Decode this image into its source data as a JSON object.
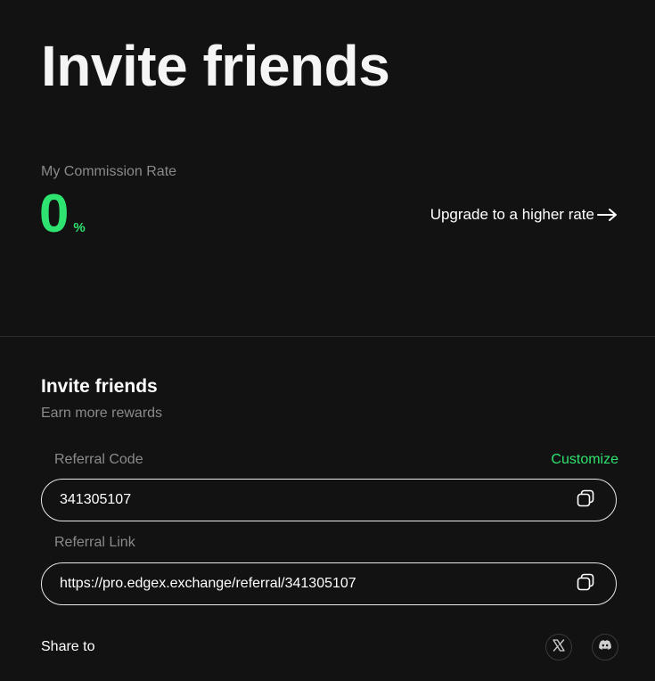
{
  "page": {
    "title": "Invite friends"
  },
  "commission": {
    "label": "My Commission Rate",
    "value": "0",
    "unit": "%",
    "upgrade_label": "Upgrade to a higher rate",
    "accent_color": "#2ee36f"
  },
  "invite": {
    "title": "Invite friends",
    "subtitle": "Earn more rewards",
    "customize_label": "Customize",
    "referral_code": {
      "label": "Referral Code",
      "value": "341305107"
    },
    "referral_link": {
      "label": "Referral Link",
      "value": "https://pro.edgex.exchange/referral/341305107"
    }
  },
  "share": {
    "label": "Share to",
    "icons": [
      "x-icon",
      "discord-icon"
    ]
  }
}
